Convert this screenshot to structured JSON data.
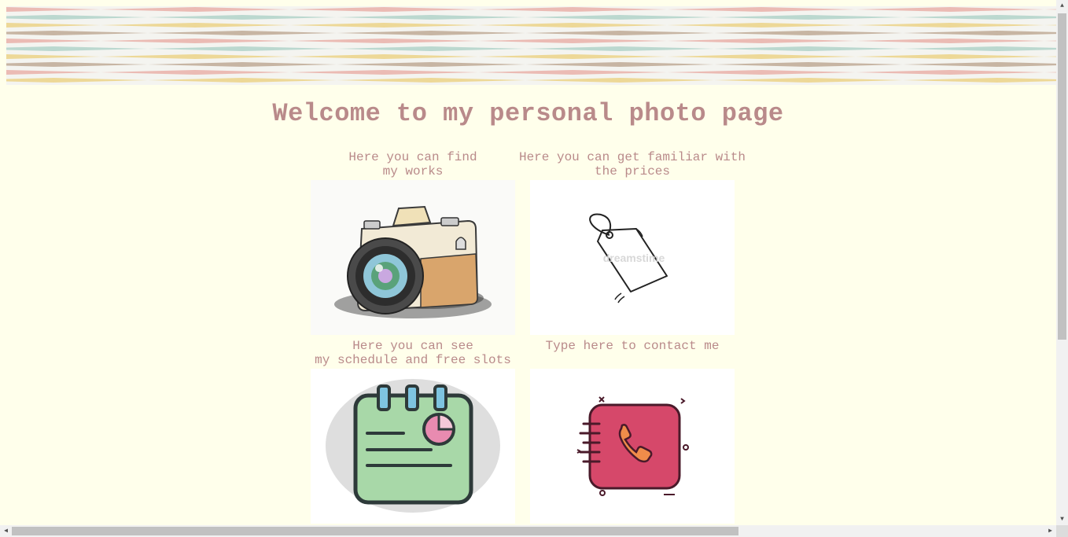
{
  "page": {
    "title": "Welcome to my personal photo page"
  },
  "sections": [
    {
      "caption": "Here you can find\nmy works",
      "icon": "camera-icon"
    },
    {
      "caption": "Here you can get familiar with\nthe prices",
      "icon": "price-tag-icon"
    },
    {
      "caption": "Here you can see\nmy schedule and free slots",
      "icon": "schedule-notepad-icon"
    },
    {
      "caption": "Type here to contact me",
      "icon": "phone-book-icon"
    }
  ],
  "watermark": "dreamstime",
  "colors": {
    "background": "#ffffeb",
    "text": "#b98a8a",
    "banner_pink": "#e8a8a0",
    "banner_teal": "#a8cfc4",
    "banner_yellow": "#ebcf7a",
    "banner_brown": "#b8a08a"
  }
}
